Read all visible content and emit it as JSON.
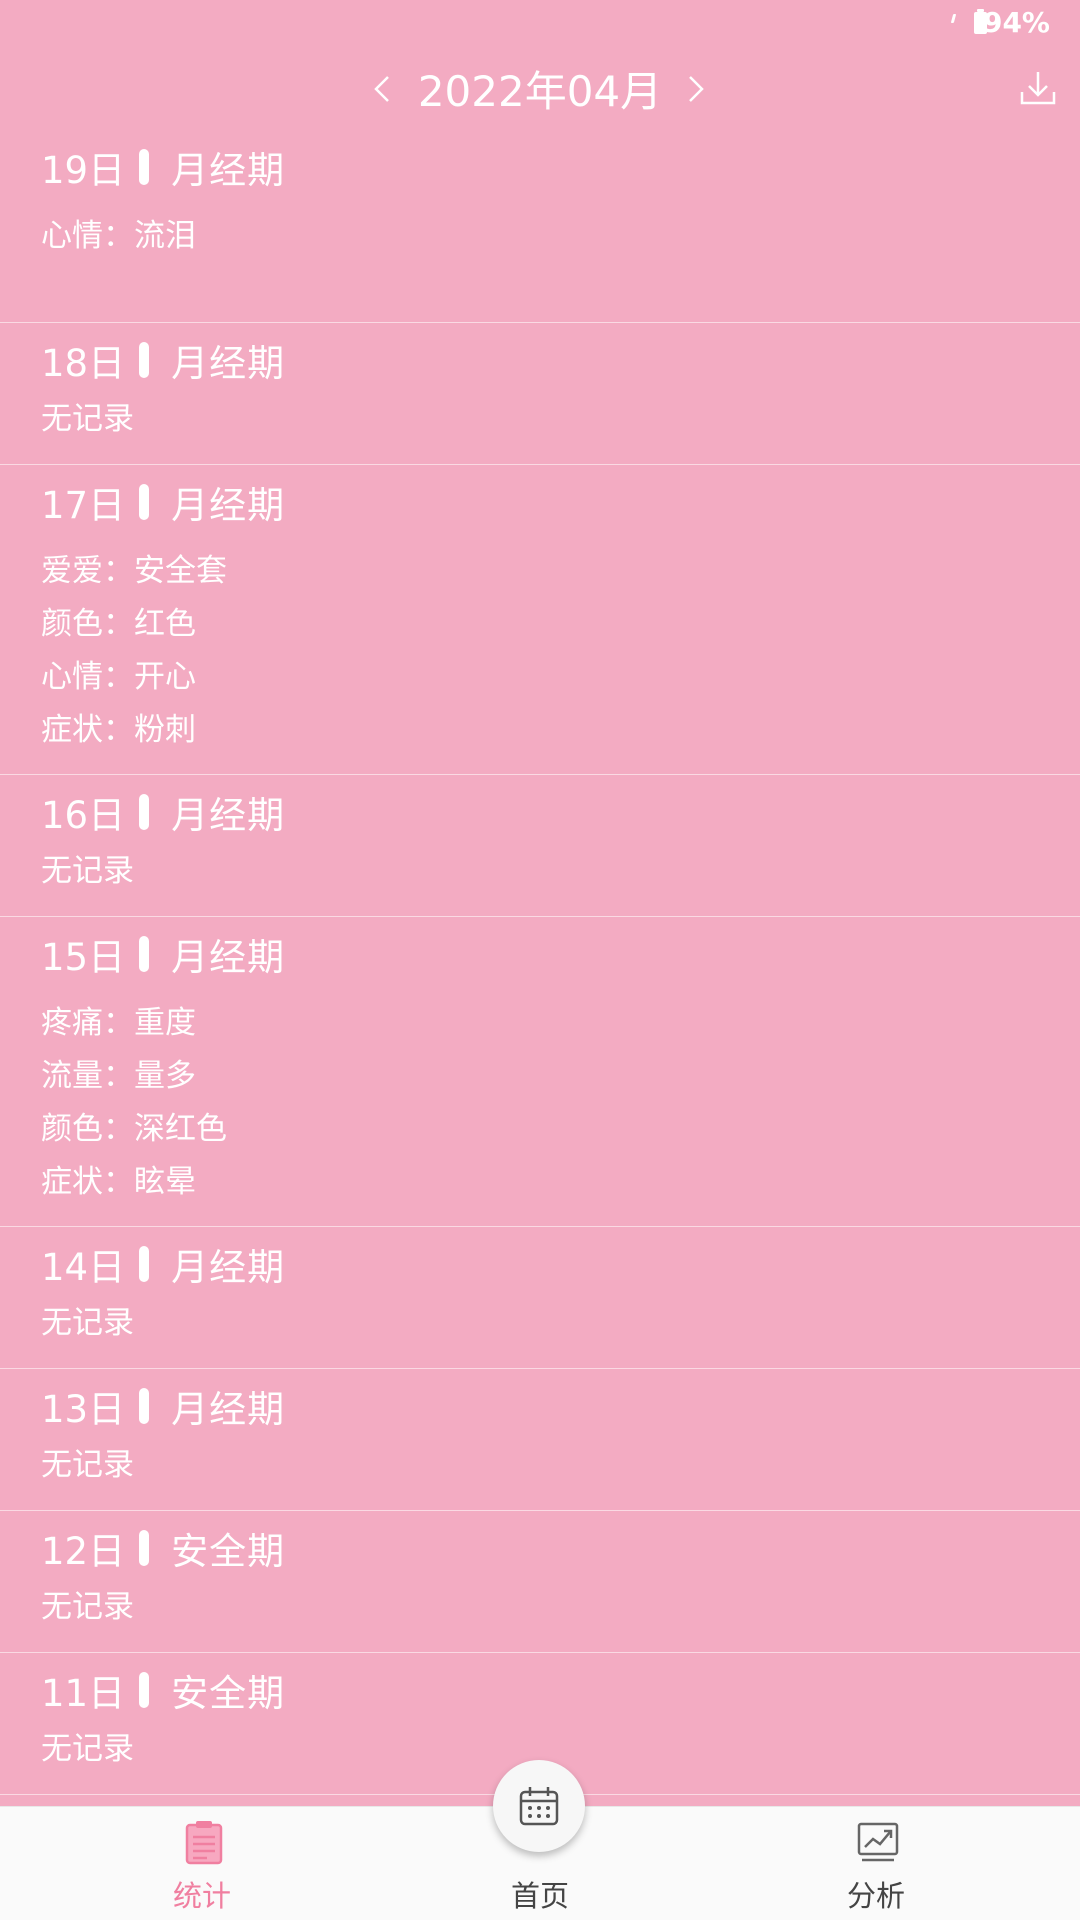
{
  "status_bar": {
    "battery": "94%"
  },
  "header": {
    "title": "2022年04月"
  },
  "colors": {
    "background": "#f3abc2",
    "accent": "#f07fa0"
  },
  "records": [
    {
      "day": "19日",
      "phase": "月经期",
      "lines": [
        "心情：流泪"
      ]
    },
    {
      "day": "18日",
      "phase": "月经期",
      "lines": [
        "无记录"
      ]
    },
    {
      "day": "17日",
      "phase": "月经期",
      "lines": [
        "爱爱：安全套",
        "颜色：红色",
        "心情：开心",
        "症状：粉刺"
      ]
    },
    {
      "day": "16日",
      "phase": "月经期",
      "lines": [
        "无记录"
      ]
    },
    {
      "day": "15日",
      "phase": "月经期",
      "lines": [
        "疼痛：重度",
        "流量：量多",
        "颜色：深红色",
        "症状：眩晕"
      ]
    },
    {
      "day": "14日",
      "phase": "月经期",
      "lines": [
        "无记录"
      ]
    },
    {
      "day": "13日",
      "phase": "月经期",
      "lines": [
        "无记录"
      ]
    },
    {
      "day": "12日",
      "phase": "安全期",
      "lines": [
        "无记录"
      ]
    },
    {
      "day": "11日",
      "phase": "安全期",
      "lines": [
        "无记录"
      ]
    }
  ],
  "bottom_nav": {
    "stats_label": "统计",
    "home_label": "首页",
    "analysis_label": "分析"
  }
}
